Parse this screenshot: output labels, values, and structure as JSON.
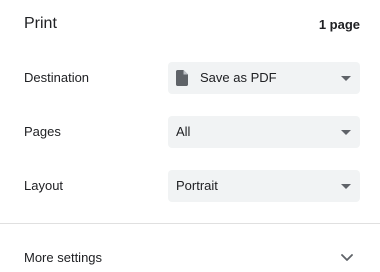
{
  "header": {
    "title": "Print",
    "page_count": "1 page"
  },
  "settings": {
    "destination": {
      "label": "Destination",
      "value": "Save as PDF",
      "icon": "file-icon"
    },
    "pages": {
      "label": "Pages",
      "value": "All"
    },
    "layout": {
      "label": "Layout",
      "value": "Portrait"
    }
  },
  "more_settings": {
    "label": "More settings",
    "icon": "chevron-down-icon"
  },
  "colors": {
    "select_background": "#f1f3f4",
    "text": "#202124",
    "icon": "#5f6368",
    "divider": "#e0e0e0"
  }
}
